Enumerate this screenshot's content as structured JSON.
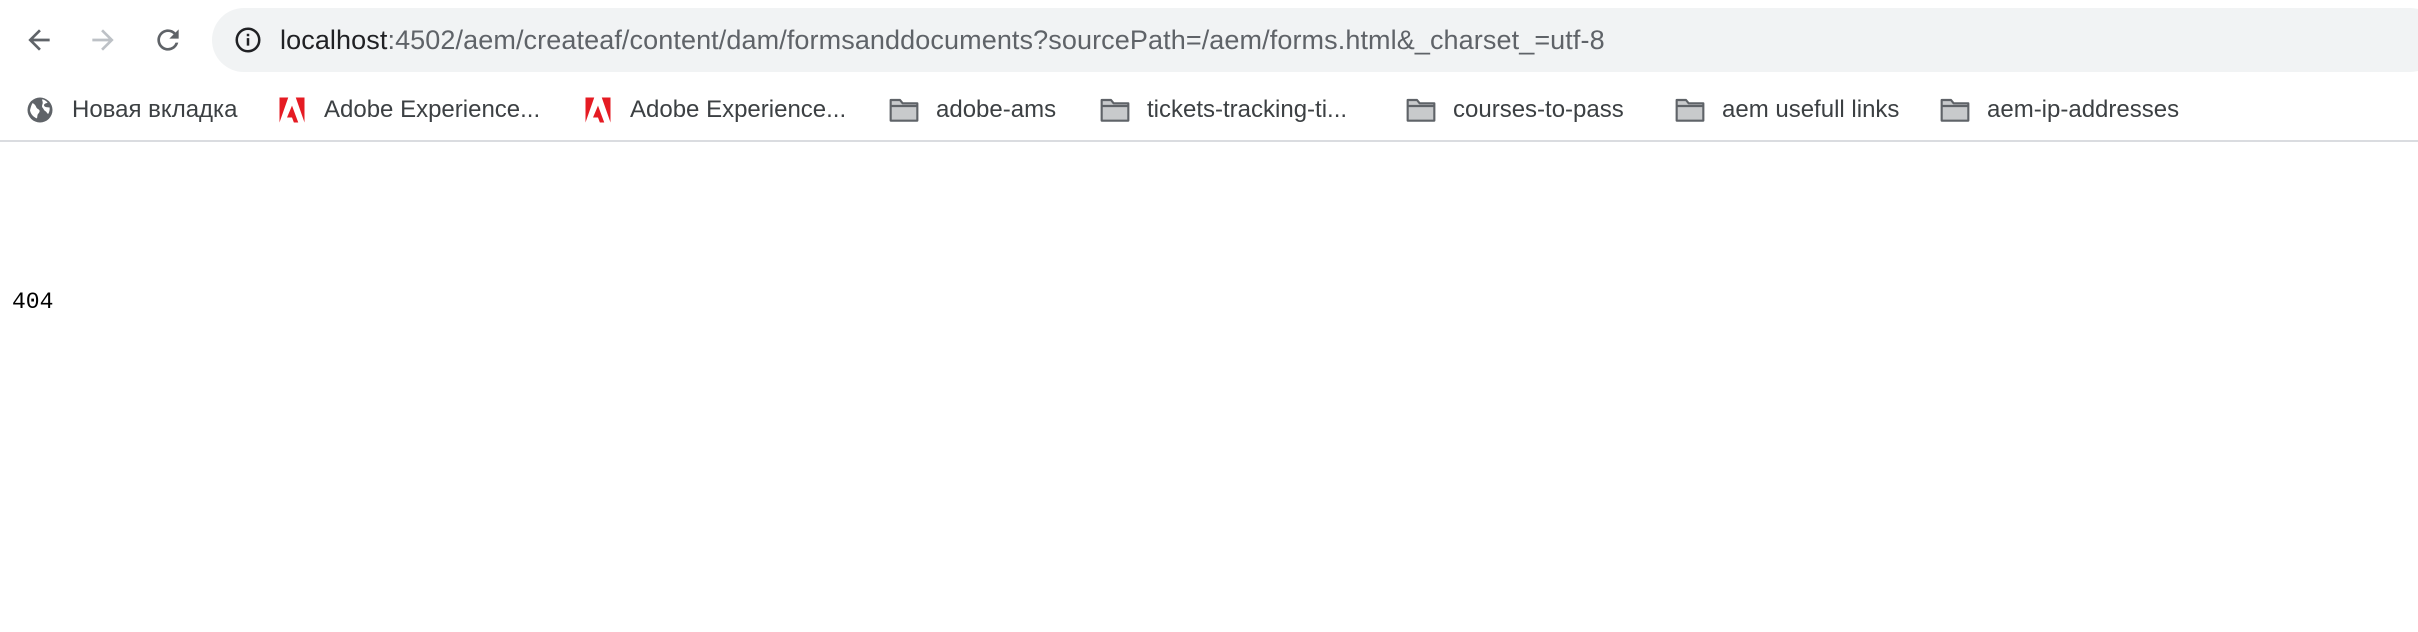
{
  "browser": {
    "toolbar": {
      "back_icon": "back-arrow-icon",
      "forward_icon": "forward-arrow-icon",
      "reload_icon": "reload-icon"
    },
    "omnibox": {
      "info_icon": "info-icon",
      "url_host": "localhost",
      "url_rest": ":4502/aem/createaf/content/dam/formsanddocuments?sourcePath=/aem/forms.html&_charset_=utf-8"
    },
    "bookmarks": [
      {
        "label": "Новая вкладка",
        "icon": "globe-icon"
      },
      {
        "label": "Adobe Experience...",
        "icon": "adobe-logo-icon",
        "color": "#e51b23"
      },
      {
        "label": "Adobe Experience...",
        "icon": "adobe-logo-icon",
        "color": "#e51b23"
      },
      {
        "label": "adobe-ams",
        "icon": "folder-icon"
      },
      {
        "label": "tickets-tracking-ti...",
        "icon": "folder-icon"
      },
      {
        "label": "courses-to-pass",
        "icon": "folder-icon"
      },
      {
        "label": "aem usefull links",
        "icon": "folder-icon"
      },
      {
        "label": "aem-ip-addresses",
        "icon": "folder-icon"
      }
    ]
  },
  "page": {
    "body_text": "404"
  }
}
